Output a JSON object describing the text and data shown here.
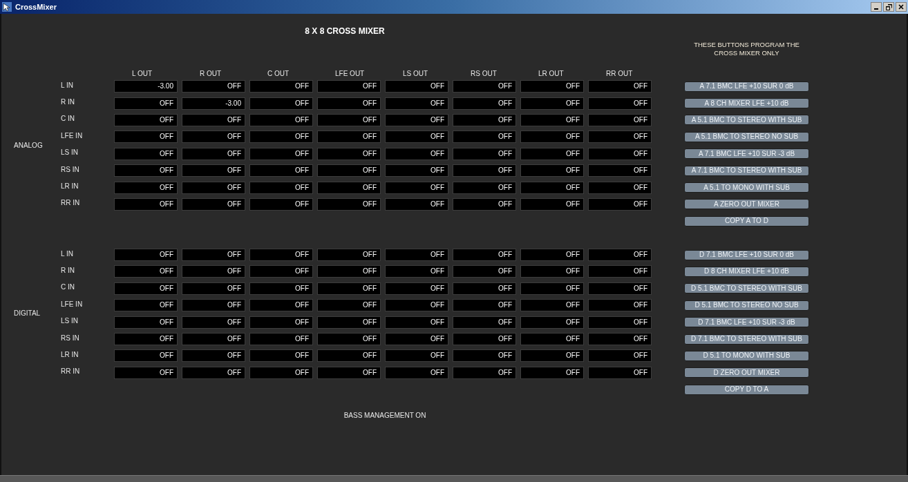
{
  "window": {
    "title": "CrossMixer"
  },
  "heading": "8 X 8 CROSS MIXER",
  "note": "THESE BUTTONS PROGRAM THE CROSS MIXER ONLY",
  "columns": [
    "L OUT",
    "R OUT",
    "C OUT",
    "LFE OUT",
    "LS OUT",
    "RS OUT",
    "LR OUT",
    "RR OUT"
  ],
  "sections": [
    {
      "label": "ANALOG",
      "rows": [
        {
          "label": "L IN",
          "cells": [
            "-3.00",
            "OFF",
            "OFF",
            "OFF",
            "OFF",
            "OFF",
            "OFF",
            "OFF"
          ]
        },
        {
          "label": "R IN",
          "cells": [
            "OFF",
            "-3.00",
            "OFF",
            "OFF",
            "OFF",
            "OFF",
            "OFF",
            "OFF"
          ]
        },
        {
          "label": "C IN",
          "cells": [
            "OFF",
            "OFF",
            "OFF",
            "OFF",
            "OFF",
            "OFF",
            "OFF",
            "OFF"
          ]
        },
        {
          "label": "LFE IN",
          "cells": [
            "OFF",
            "OFF",
            "OFF",
            "OFF",
            "OFF",
            "OFF",
            "OFF",
            "OFF"
          ]
        },
        {
          "label": "LS IN",
          "cells": [
            "OFF",
            "OFF",
            "OFF",
            "OFF",
            "OFF",
            "OFF",
            "OFF",
            "OFF"
          ]
        },
        {
          "label": "RS IN",
          "cells": [
            "OFF",
            "OFF",
            "OFF",
            "OFF",
            "OFF",
            "OFF",
            "OFF",
            "OFF"
          ]
        },
        {
          "label": "LR IN",
          "cells": [
            "OFF",
            "OFF",
            "OFF",
            "OFF",
            "OFF",
            "OFF",
            "OFF",
            "OFF"
          ]
        },
        {
          "label": "RR IN",
          "cells": [
            "OFF",
            "OFF",
            "OFF",
            "OFF",
            "OFF",
            "OFF",
            "OFF",
            "OFF"
          ]
        }
      ],
      "presets": [
        "A 7.1 BMC LFE +10 SUR 0 dB",
        "A 8 CH MIXER LFE +10 dB",
        "A 5.1 BMC TO STEREO WITH SUB",
        "A 5.1 BMC TO STEREO NO SUB",
        "A 7.1 BMC LFE +10 SUR -3 dB",
        "A 7.1 BMC TO STEREO WITH SUB",
        "A 5.1 TO MONO WITH SUB",
        "A ZERO OUT MIXER",
        "COPY A TO D"
      ]
    },
    {
      "label": "DIGITAL",
      "rows": [
        {
          "label": "L IN",
          "cells": [
            "OFF",
            "OFF",
            "OFF",
            "OFF",
            "OFF",
            "OFF",
            "OFF",
            "OFF"
          ]
        },
        {
          "label": "R IN",
          "cells": [
            "OFF",
            "OFF",
            "OFF",
            "OFF",
            "OFF",
            "OFF",
            "OFF",
            "OFF"
          ]
        },
        {
          "label": "C IN",
          "cells": [
            "OFF",
            "OFF",
            "OFF",
            "OFF",
            "OFF",
            "OFF",
            "OFF",
            "OFF"
          ]
        },
        {
          "label": "LFE IN",
          "cells": [
            "OFF",
            "OFF",
            "OFF",
            "OFF",
            "OFF",
            "OFF",
            "OFF",
            "OFF"
          ]
        },
        {
          "label": "LS IN",
          "cells": [
            "OFF",
            "OFF",
            "OFF",
            "OFF",
            "OFF",
            "OFF",
            "OFF",
            "OFF"
          ]
        },
        {
          "label": "RS IN",
          "cells": [
            "OFF",
            "OFF",
            "OFF",
            "OFF",
            "OFF",
            "OFF",
            "OFF",
            "OFF"
          ]
        },
        {
          "label": "LR IN",
          "cells": [
            "OFF",
            "OFF",
            "OFF",
            "OFF",
            "OFF",
            "OFF",
            "OFF",
            "OFF"
          ]
        },
        {
          "label": "RR IN",
          "cells": [
            "OFF",
            "OFF",
            "OFF",
            "OFF",
            "OFF",
            "OFF",
            "OFF",
            "OFF"
          ]
        }
      ],
      "presets": [
        "D 7.1 BMC LFE +10 SUR 0 dB",
        "D 8 CH MIXER LFE +10 dB",
        "D 5.1 BMC TO STEREO WITH SUB",
        "D 5.1 BMC TO STEREO NO SUB",
        "D 7.1 BMC LFE +10 SUR -3 dB",
        "D 7.1 BMC TO STEREO WITH SUB",
        "D 5.1 TO MONO WITH SUB",
        "D ZERO OUT MIXER",
        "COPY D TO A"
      ]
    }
  ],
  "status": "BASS MANAGEMENT ON"
}
